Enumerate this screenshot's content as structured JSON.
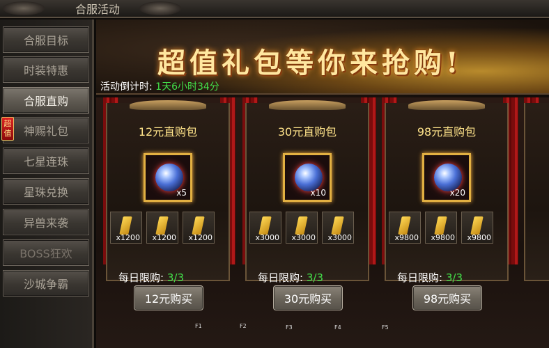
{
  "title": "合服活动",
  "sidebar": {
    "items": [
      {
        "label": "合服目标",
        "state": "normal"
      },
      {
        "label": "时装特惠",
        "state": "normal"
      },
      {
        "label": "合服直购",
        "state": "active"
      },
      {
        "label": "神赐礼包",
        "state": "normal"
      },
      {
        "label": "七星连珠",
        "state": "normal"
      },
      {
        "label": "星珠兑换",
        "state": "normal"
      },
      {
        "label": "异兽来袭",
        "state": "normal"
      },
      {
        "label": "BOSS狂欢",
        "state": "disabled"
      },
      {
        "label": "沙城争霸",
        "state": "normal"
      }
    ],
    "hot_badge": "超值"
  },
  "banner": {
    "headline": "超值礼包等你来抢购!",
    "countdown_label": "活动倒计时:",
    "countdown_value": "1天6小时34分"
  },
  "packs": [
    {
      "name": "12元直购包",
      "main_qty": "x5",
      "slots": [
        "x1200",
        "x1200",
        "x1200"
      ],
      "limit_label": "每日限购:",
      "limit_value": "3/3",
      "buy_label": "12元购买"
    },
    {
      "name": "30元直购包",
      "main_qty": "x10",
      "slots": [
        "x3000",
        "x3000",
        "x3000"
      ],
      "limit_label": "每日限购:",
      "limit_value": "3/3",
      "buy_label": "30元购买"
    },
    {
      "name": "98元直购包",
      "main_qty": "x20",
      "slots": [
        "x9800",
        "x9800",
        "x9800"
      ],
      "limit_label": "每日限购:",
      "limit_value": "3/3",
      "buy_label": "98元购买"
    }
  ],
  "fkeys": [
    "F1",
    "F2",
    "F3",
    "F4",
    "F5"
  ],
  "colors": {
    "accent_green": "#43e04a",
    "title_gold": "#ffe38a"
  }
}
